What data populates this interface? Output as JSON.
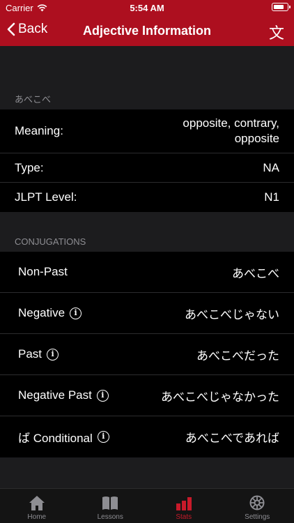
{
  "status": {
    "carrier": "Carrier",
    "time": "5:54 AM"
  },
  "nav": {
    "back_label": "Back",
    "title": "Adjective Information",
    "kanji_glyph": "文"
  },
  "word": {
    "kana": "あべこべ"
  },
  "info": {
    "meaning_label": "Meaning:",
    "meaning_value": "opposite, contrary, opposite",
    "type_label": "Type:",
    "type_value": "NA",
    "jlpt_label": "JLPT Level:",
    "jlpt_value": "N1"
  },
  "conjugations": {
    "header": "CONJUGATIONS",
    "rows": [
      {
        "label": "Non-Past",
        "value": "あべこべ",
        "has_info": false
      },
      {
        "label": "Negative",
        "value": "あべこべじゃない",
        "has_info": true
      },
      {
        "label": "Past",
        "value": "あべこべだった",
        "has_info": true
      },
      {
        "label": "Negative Past",
        "value": "あべこべじゃなかった",
        "has_info": true
      },
      {
        "label": "ば Conditional",
        "value": "あべこべであれば",
        "has_info": true
      }
    ]
  },
  "tabs": [
    {
      "label": "Home",
      "icon": "home-icon"
    },
    {
      "label": "Lessons",
      "icon": "book-icon"
    },
    {
      "label": "Stats",
      "icon": "stats-icon"
    },
    {
      "label": "Settings",
      "icon": "settings-icon"
    }
  ],
  "colors": {
    "accent": "#ad0f1f",
    "active_tab": "#c81a2a"
  }
}
